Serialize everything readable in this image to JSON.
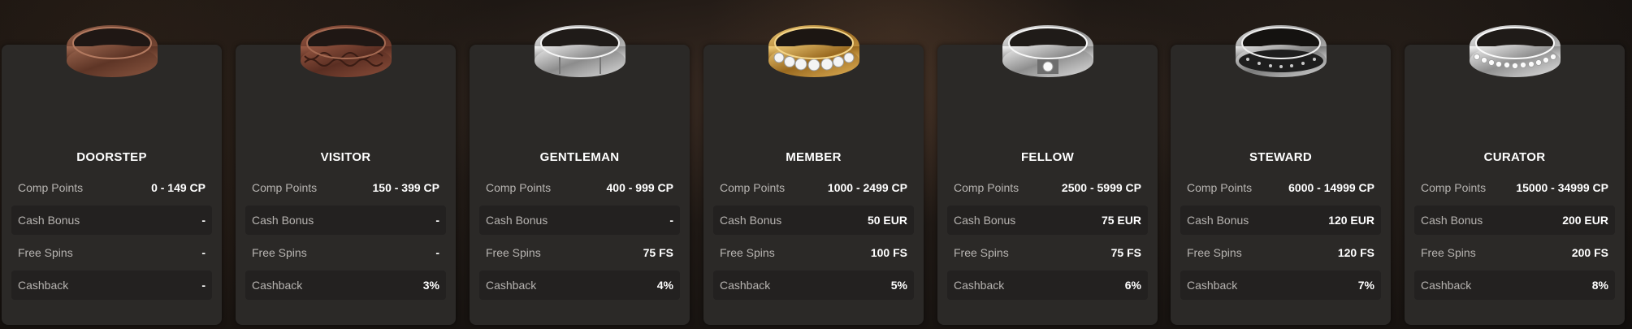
{
  "tiers": [
    {
      "name": "DOORSTEP",
      "ring_icon": "copper-plain-ring-icon",
      "ring_color": "#7a4a36",
      "rows": [
        {
          "label": "Comp Points",
          "value": "0 - 149 CP"
        },
        {
          "label": "Cash Bonus",
          "value": "-"
        },
        {
          "label": "Free Spins",
          "value": "-"
        },
        {
          "label": "Cashback",
          "value": "-"
        }
      ]
    },
    {
      "name": "VISITOR",
      "ring_icon": "copper-engraved-ring-icon",
      "ring_color": "#7b4534",
      "rows": [
        {
          "label": "Comp Points",
          "value": "150 - 399 CP"
        },
        {
          "label": "Cash Bonus",
          "value": "-"
        },
        {
          "label": "Free Spins",
          "value": "-"
        },
        {
          "label": "Cashback",
          "value": "3%"
        }
      ]
    },
    {
      "name": "GENTLEMAN",
      "ring_icon": "silver-ring-icon",
      "ring_color": "#c9c9c9",
      "rows": [
        {
          "label": "Comp Points",
          "value": "400 - 999 CP"
        },
        {
          "label": "Cash Bonus",
          "value": "-"
        },
        {
          "label": "Free Spins",
          "value": "75 FS"
        },
        {
          "label": "Cashback",
          "value": "4%"
        }
      ]
    },
    {
      "name": "MEMBER",
      "ring_icon": "gold-diamond-ring-icon",
      "ring_color": "#c99a3a",
      "rows": [
        {
          "label": "Comp Points",
          "value": "1000 - 2499 CP"
        },
        {
          "label": "Cash Bonus",
          "value": "50 EUR"
        },
        {
          "label": "Free Spins",
          "value": "100 FS"
        },
        {
          "label": "Cashback",
          "value": "5%"
        }
      ]
    },
    {
      "name": "FELLOW",
      "ring_icon": "silver-solitaire-ring-icon",
      "ring_color": "#d0d0d0",
      "rows": [
        {
          "label": "Comp Points",
          "value": "2500 - 5999 CP"
        },
        {
          "label": "Cash Bonus",
          "value": "75 EUR"
        },
        {
          "label": "Free Spins",
          "value": "75 FS"
        },
        {
          "label": "Cashback",
          "value": "6%"
        }
      ]
    },
    {
      "name": "STEWARD",
      "ring_icon": "black-studded-ring-icon",
      "ring_color": "#2a2a2a",
      "rows": [
        {
          "label": "Comp Points",
          "value": "6000 - 14999 CP"
        },
        {
          "label": "Cash Bonus",
          "value": "120 EUR"
        },
        {
          "label": "Free Spins",
          "value": "120 FS"
        },
        {
          "label": "Cashback",
          "value": "7%"
        }
      ]
    },
    {
      "name": "CURATOR",
      "ring_icon": "platinum-diamond-ring-icon",
      "ring_color": "#dcdcdc",
      "rows": [
        {
          "label": "Comp Points",
          "value": "15000 - 34999 CP"
        },
        {
          "label": "Cash Bonus",
          "value": "200 EUR"
        },
        {
          "label": "Free Spins",
          "value": "200 FS"
        },
        {
          "label": "Cashback",
          "value": "8%"
        }
      ]
    }
  ]
}
